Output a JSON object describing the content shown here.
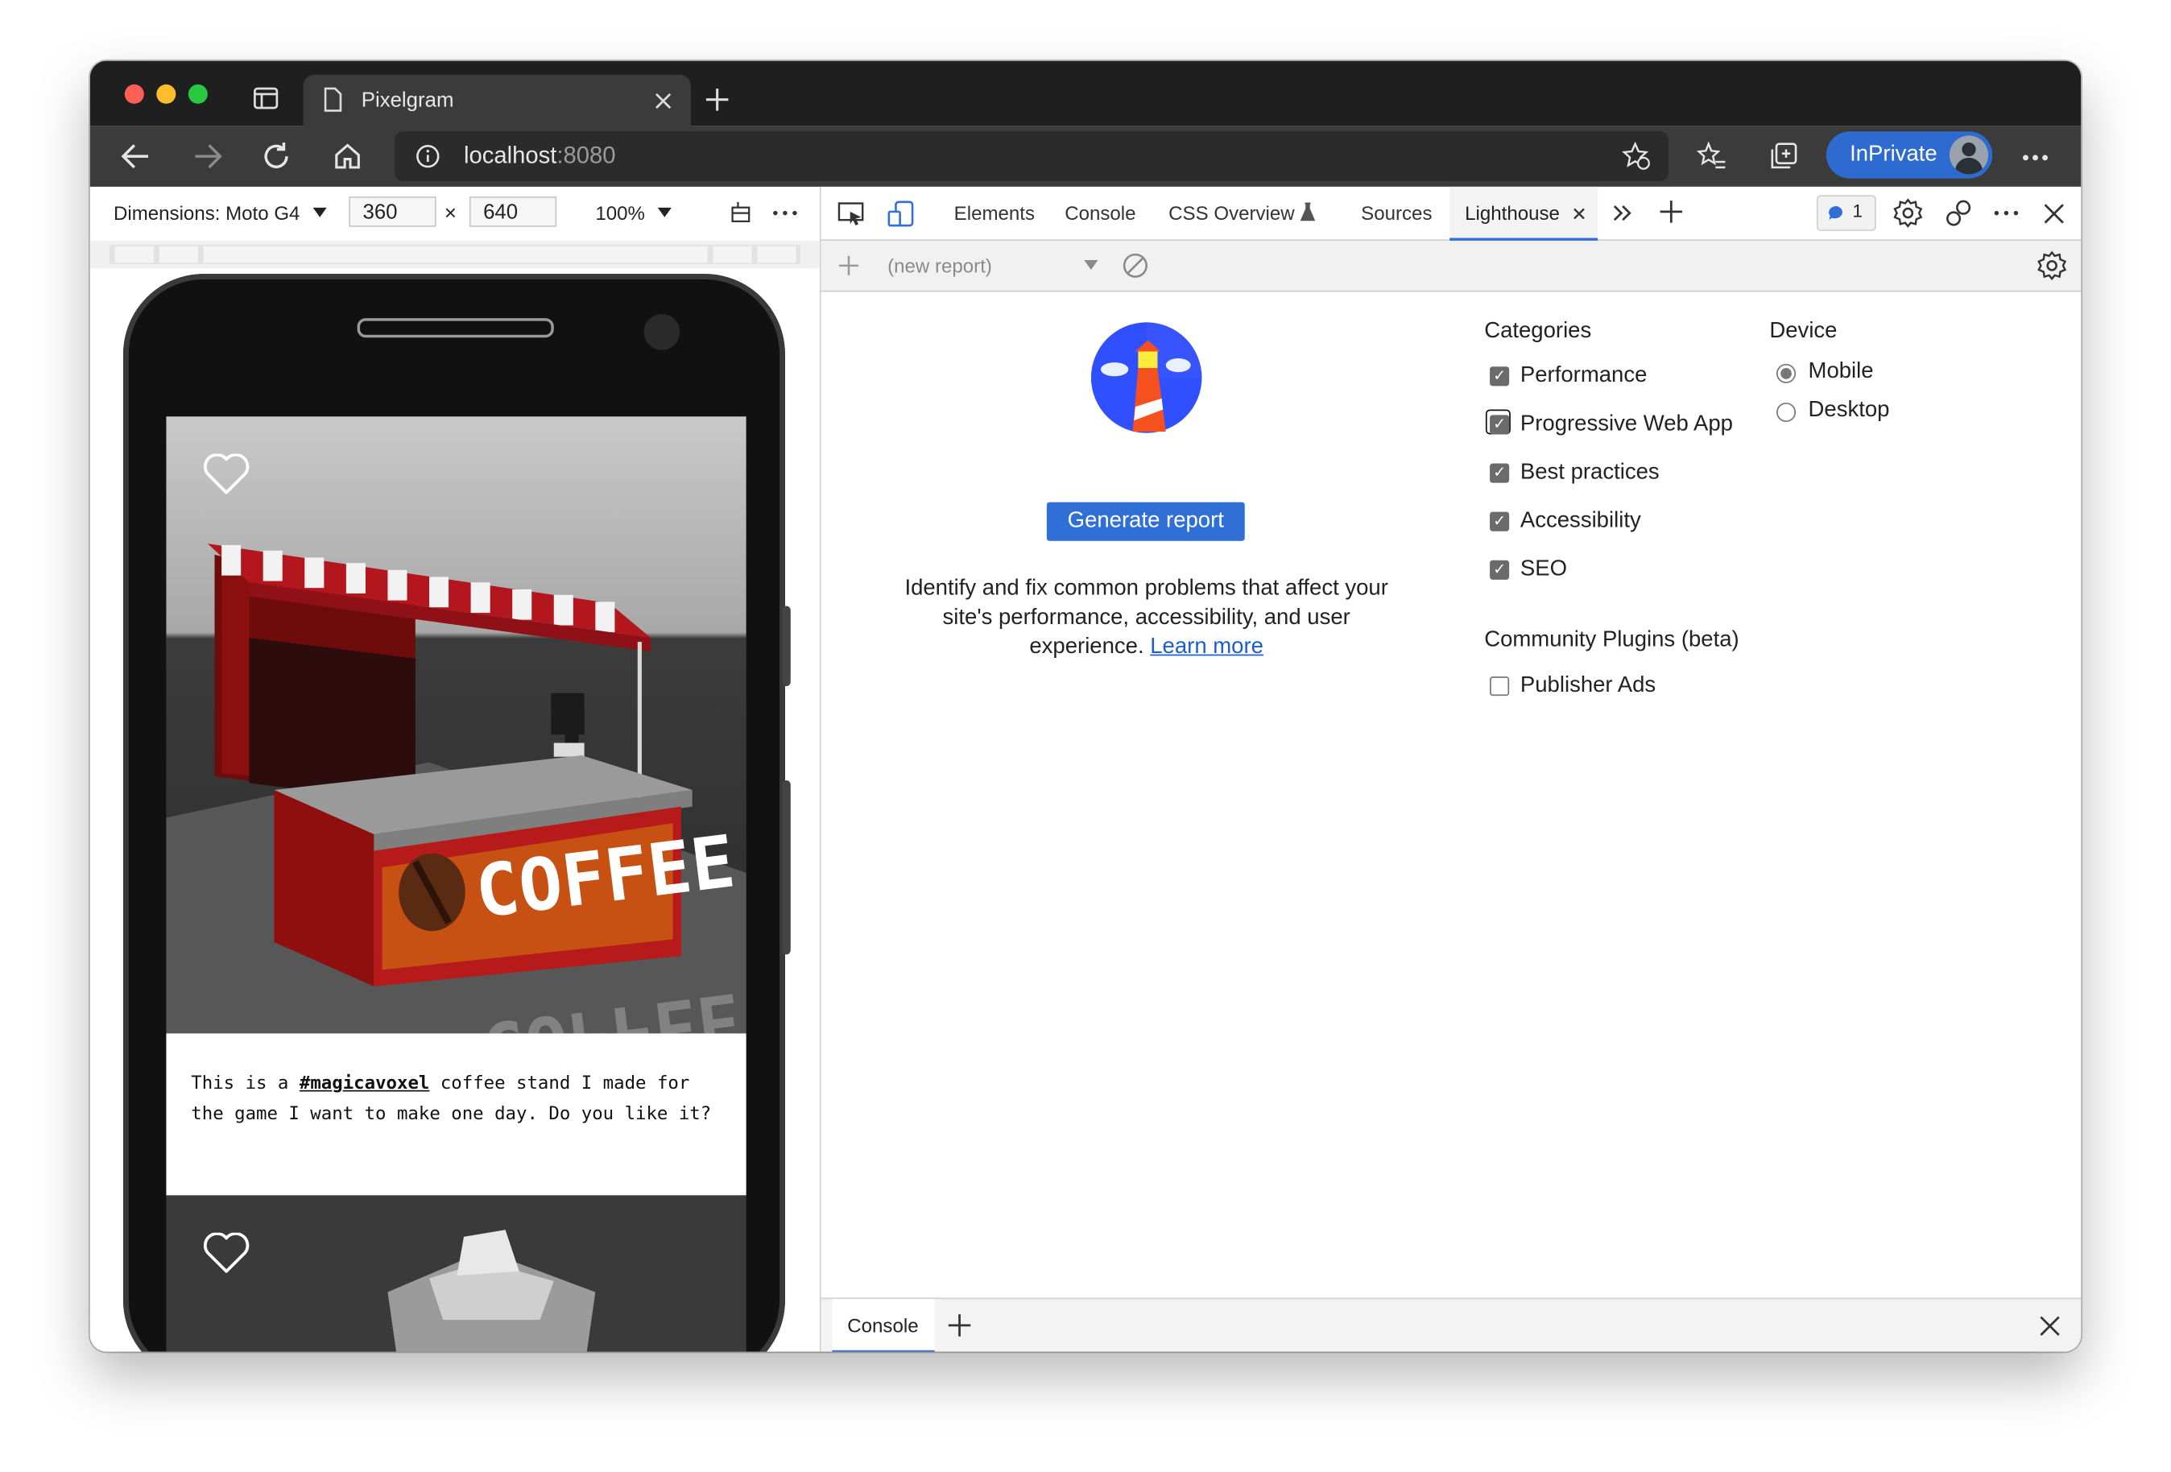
{
  "browser": {
    "tab_title": "Pixelgram",
    "url_host": "localhost",
    "url_port": ":8080",
    "inprivate_label": "InPrivate"
  },
  "device_toolbar": {
    "dimensions_label": "Dimensions: Moto G4",
    "width": "360",
    "times": "×",
    "height": "640",
    "zoom": "100%"
  },
  "post": {
    "caption_pre": "This is a ",
    "caption_tag": "#magicavoxel",
    "caption_post": " coffee stand I made for the game I want to make one day. Do you like it?",
    "sign_text": "COFFEE"
  },
  "devtools": {
    "tabs": [
      "Elements",
      "Console",
      "CSS Overview",
      "Sources",
      "Lighthouse"
    ],
    "issues_count": "1",
    "new_report": "(new report)"
  },
  "lighthouse": {
    "generate_label": "Generate report",
    "description": "Identify and fix common problems that affect your site's performance, accessibility, and user experience. ",
    "learn_more": "Learn more",
    "categories_title": "Categories",
    "categories": [
      {
        "label": "Performance",
        "checked": true
      },
      {
        "label": "Progressive Web App",
        "checked": true
      },
      {
        "label": "Best practices",
        "checked": true
      },
      {
        "label": "Accessibility",
        "checked": true
      },
      {
        "label": "SEO",
        "checked": true
      }
    ],
    "plugins_title": "Community Plugins (beta)",
    "plugins": [
      {
        "label": "Publisher Ads",
        "checked": false
      }
    ],
    "device_title": "Device",
    "devices": [
      {
        "label": "Mobile",
        "selected": true
      },
      {
        "label": "Desktop",
        "selected": false
      }
    ]
  },
  "drawer": {
    "tab_label": "Console"
  },
  "colors": {
    "accent": "#2f6fd6",
    "titlebar": "#1f1f1f",
    "toolbar": "#3b3b3b"
  }
}
